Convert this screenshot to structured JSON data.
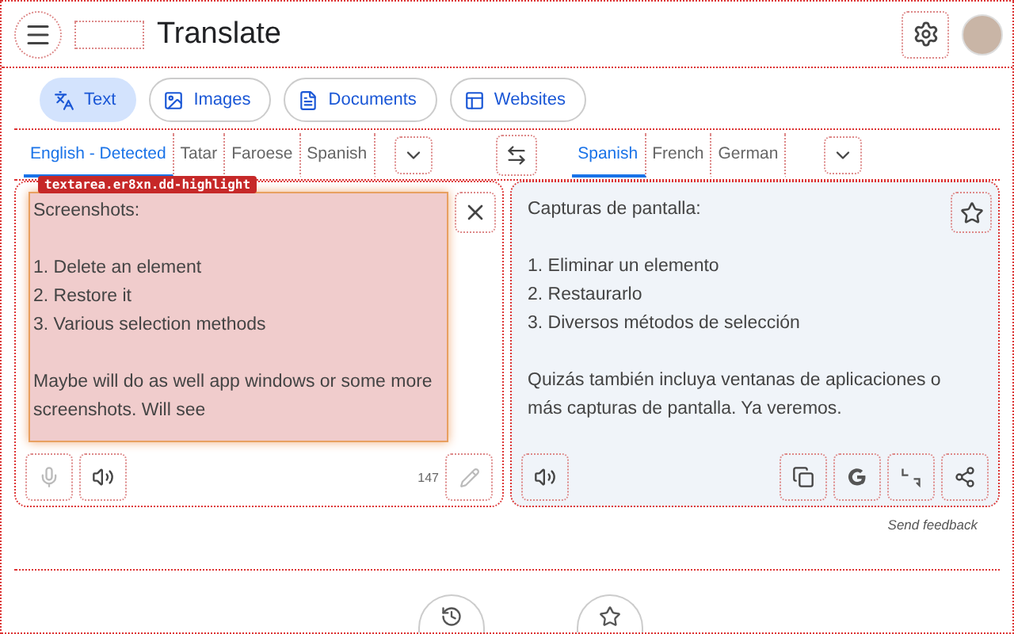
{
  "header": {
    "title": "Translate"
  },
  "modes": [
    {
      "label": "Text",
      "selected": true
    },
    {
      "label": "Images",
      "selected": false
    },
    {
      "label": "Documents",
      "selected": false
    },
    {
      "label": "Websites",
      "selected": false
    }
  ],
  "source_languages": [
    {
      "label": "English - Detected",
      "selected": true
    },
    {
      "label": "Tatar",
      "selected": false
    },
    {
      "label": "Faroese",
      "selected": false
    },
    {
      "label": "Spanish",
      "selected": false
    }
  ],
  "target_languages": [
    {
      "label": "Spanish",
      "selected": true
    },
    {
      "label": "French",
      "selected": false
    },
    {
      "label": "German",
      "selected": false
    }
  ],
  "highlight_label": "textarea.er8xn.dd-highlight",
  "source": {
    "paragraphs": [
      [
        "Screenshots:"
      ],
      [
        "1. Delete an element",
        "2. Restore it",
        "3. Various selection methods"
      ],
      [
        "Maybe will do as well app windows or some more screenshots. Will see"
      ]
    ],
    "char_count": "147"
  },
  "translation": {
    "paragraphs": [
      [
        "Capturas de pantalla:"
      ],
      [
        "1. Eliminar un elemento",
        "2. Restaurarlo",
        "3. Diversos métodos de selección"
      ],
      [
        "Quizás también incluya ventanas de aplicaciones o más capturas de pantalla. Ya veremos."
      ]
    ]
  },
  "feedback": "Send feedback"
}
